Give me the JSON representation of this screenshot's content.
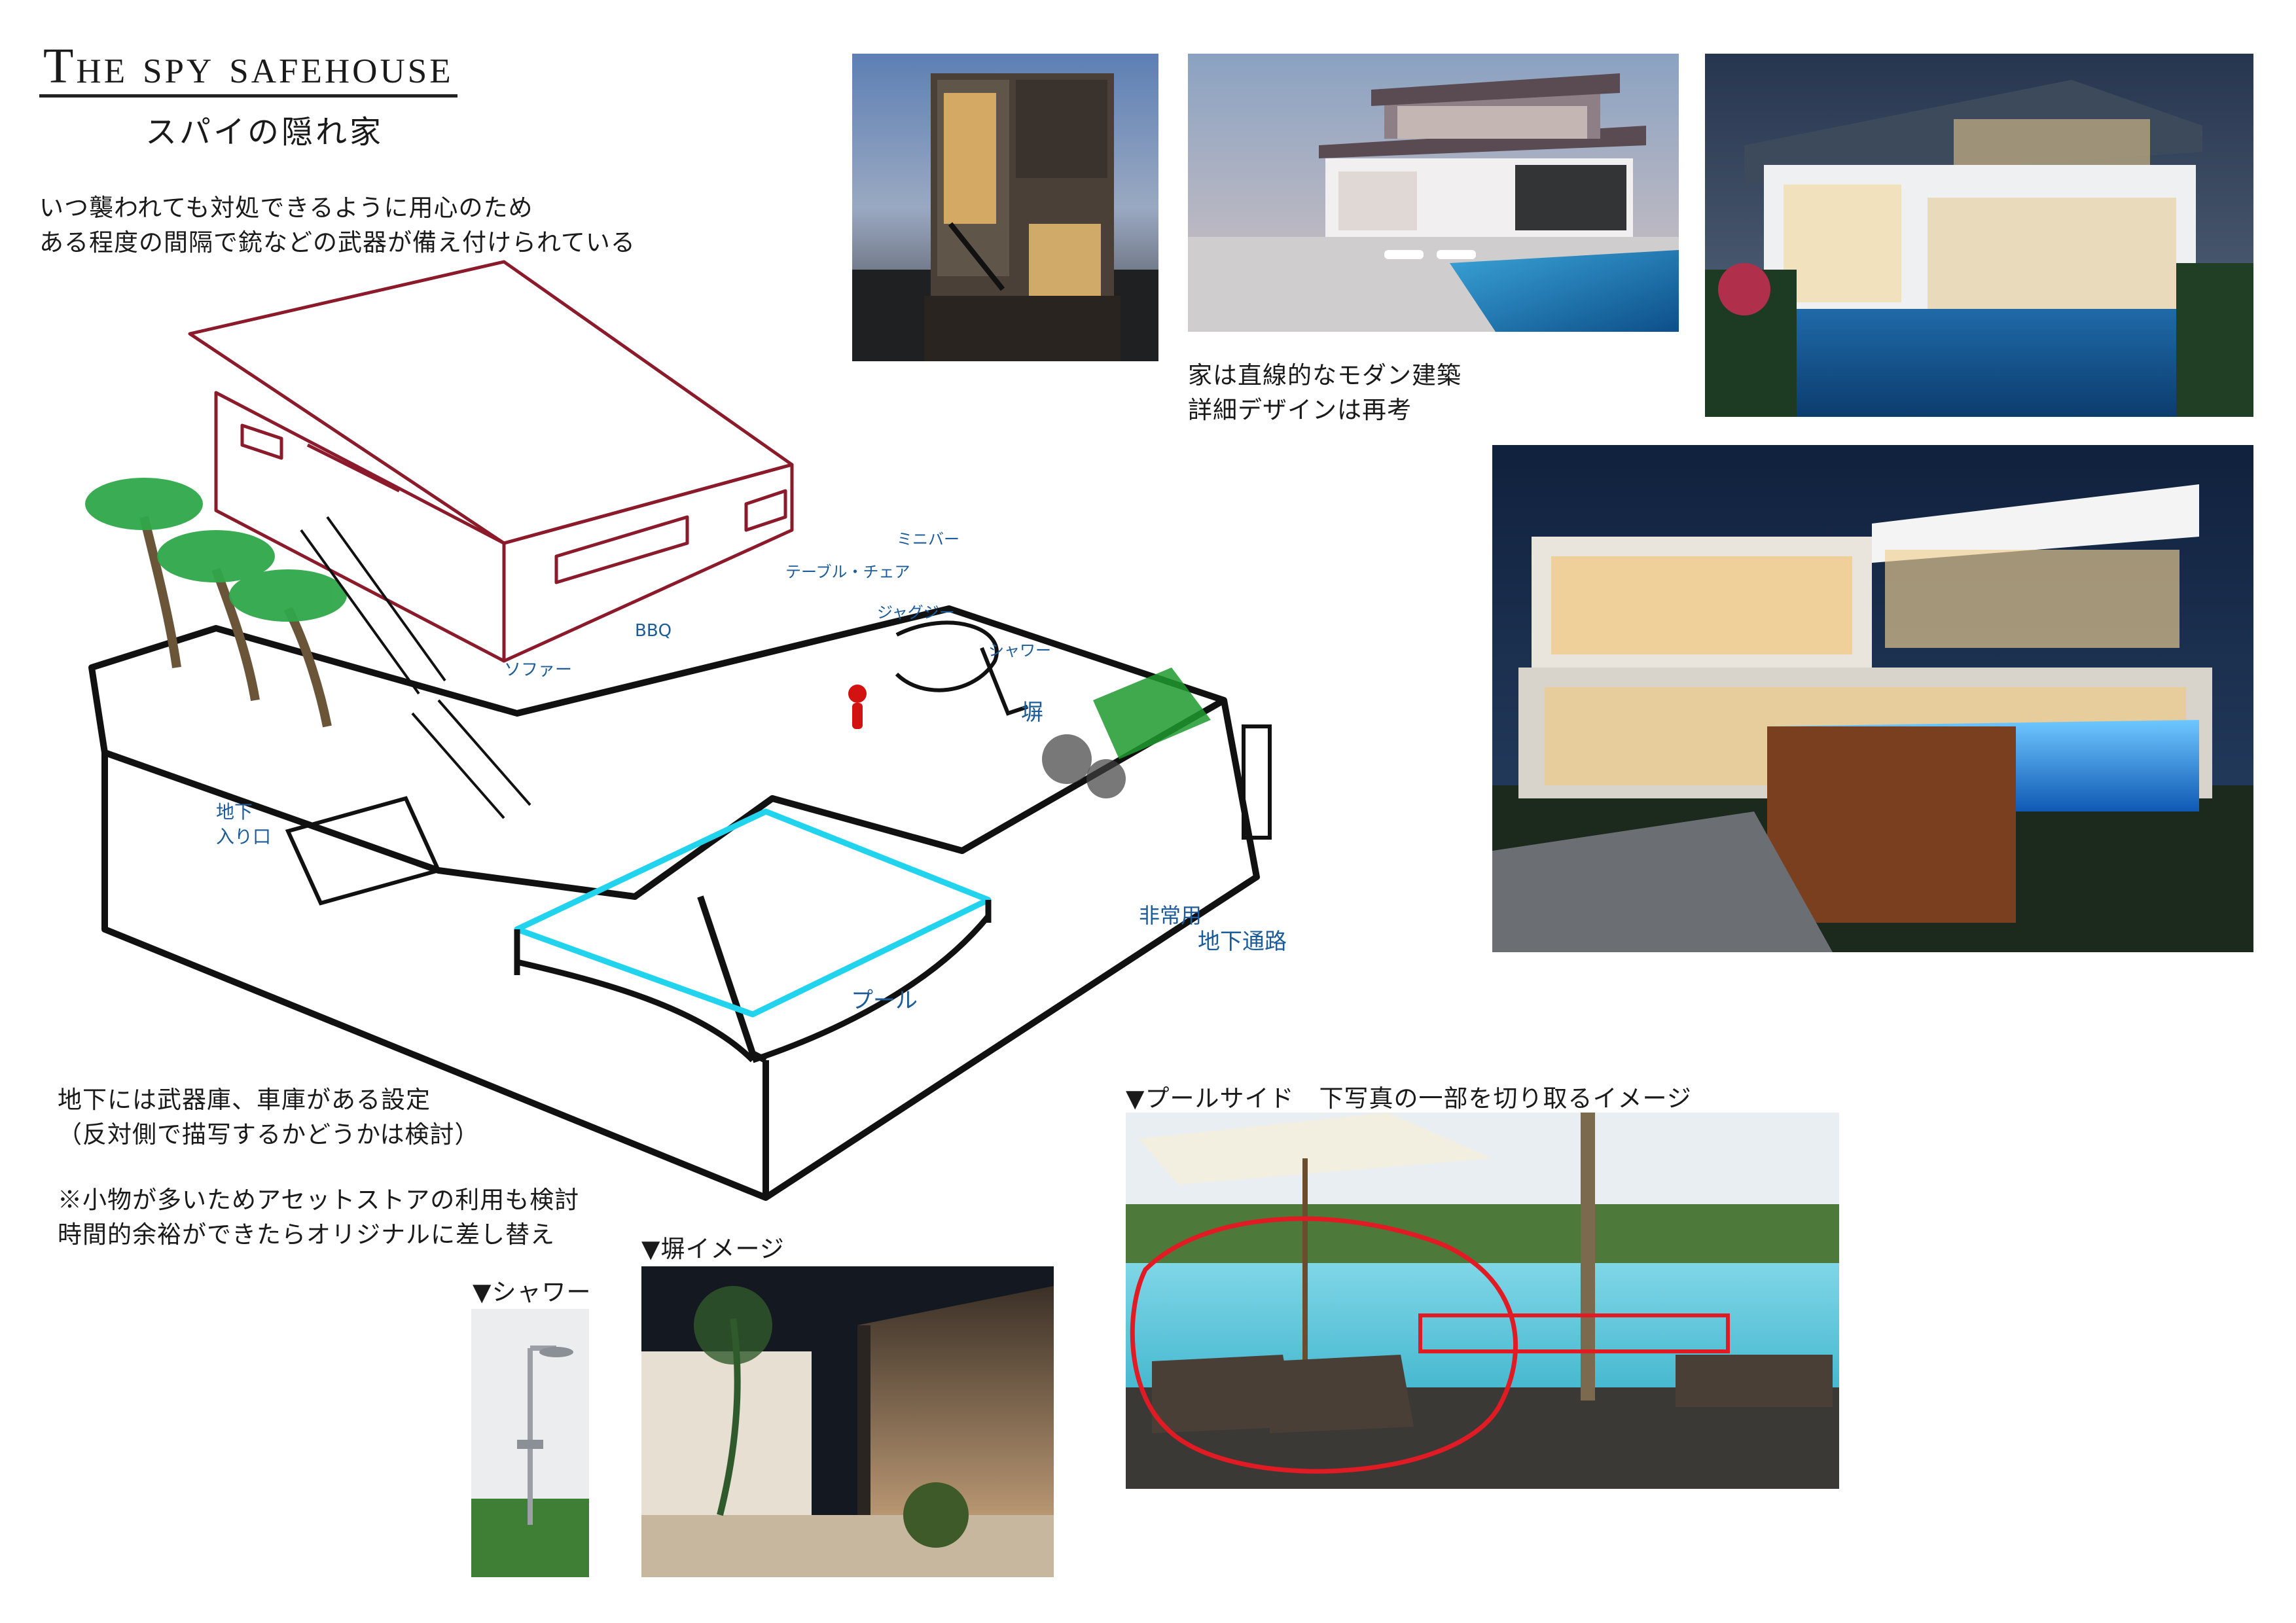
{
  "header": {
    "title": "The spy safehouse",
    "subtitle": "スパイの隠れ家"
  },
  "notes": {
    "intro": "いつ襲われても対処できるように用心のため\nある程度の間隔で銃などの武器が備え付けられている",
    "house_style": "家は直線的なモダン建築\n詳細デザインは再考",
    "underground": "地下には武器庫、車庫がある設定\n（反対側で描写するかどうかは検討）",
    "assets": "※小物が多いためアセットストアの利用も検討\n時間的余裕ができたらオリジナルに差し替え"
  },
  "captions": {
    "shower": "▼シャワー",
    "wall": "▼塀イメージ",
    "poolside": "▼プールサイド　下写真の一部を切り取るイメージ"
  },
  "sketch_labels": {
    "sofa": "ソファー",
    "bbq": "BBQ",
    "table_chair": "テーブル・チェア",
    "mini_bar": "ミニバー",
    "jacuzzi": "ジャグジー",
    "shower": "シャワー",
    "wall": "塀",
    "underground_entrance_1": "地下",
    "underground_entrance_2": "入り口",
    "pool": "プール",
    "emergency": "非常用",
    "underground_passage": "地下通路"
  },
  "colors": {
    "house_outline": "#8b1a2b",
    "pool_outline": "#22d3ee",
    "vegetation": "#1f9a2e",
    "label_ink": "#1d5c9a",
    "figure": "#d31212",
    "highlight": "#e01b24"
  }
}
